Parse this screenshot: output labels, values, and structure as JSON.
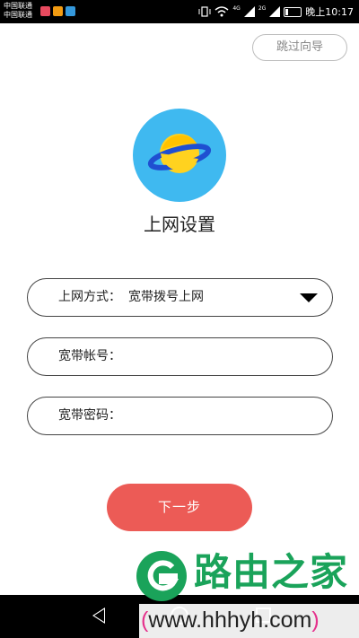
{
  "status_bar": {
    "carrier_1": "中国联通",
    "carrier_2": "中国联通",
    "net_1": "4G",
    "net_2": "2G",
    "time": "晚上10:17",
    "battery_level": 0.2
  },
  "header": {
    "skip_label": "跳过向导"
  },
  "logo": {
    "icon": "planet-icon",
    "bg_color": "#3fb9f0",
    "planet_color": "#ffd21f",
    "ring_color": "#1f4fd1"
  },
  "page": {
    "title": "上网设置"
  },
  "form": {
    "connection_type": {
      "label": "上网方式：",
      "value": "宽带拨号上网",
      "icon": "caret-down-icon"
    },
    "account": {
      "label": "宽带帐号：",
      "value": ""
    },
    "password": {
      "label": "宽带密码：",
      "value": ""
    }
  },
  "actions": {
    "next_label": "下一步",
    "next_color": "#ec5b56"
  },
  "nav_bar": {
    "back_icon": "back-icon",
    "home_icon": "home-icon",
    "recent_icon": "recent-apps-icon"
  },
  "watermark": {
    "name": "路由之家",
    "url_prefix": "(",
    "url": "www.hhhyh.com",
    "url_suffix": ")",
    "brand_color": "#1aa35a"
  }
}
